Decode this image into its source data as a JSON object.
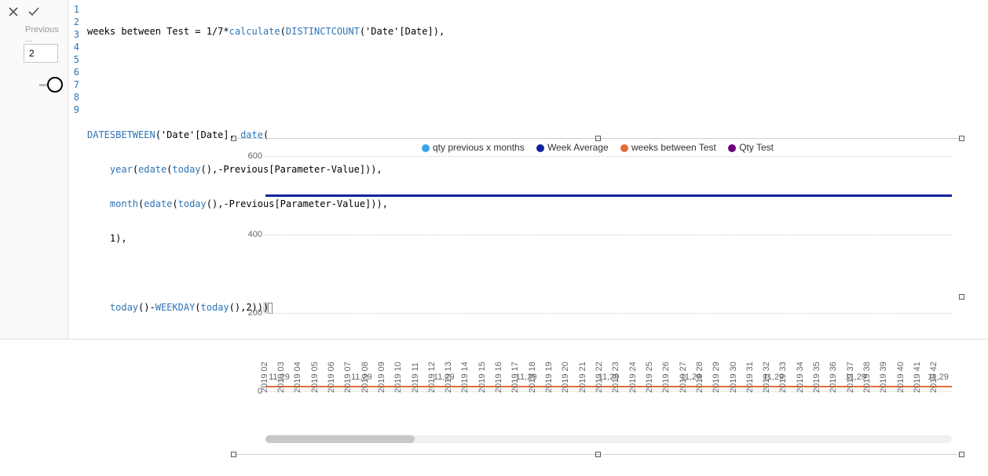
{
  "controls": {
    "truncated_label": "Previous ...",
    "param_value": "2"
  },
  "editor": {
    "lines": [
      "weeks between Test = 1/7*calculate(DISTINCTCOUNT('Date'[Date]),",
      "",
      "",
      "DATESBETWEEN('Date'[Date], date(",
      "    year(edate(today(),-Previous[Parameter-Value])),",
      "    month(edate(today(),-Previous[Parameter-Value])),",
      "    1),",
      "",
      "    today()-WEEKDAY(today(),2)))"
    ],
    "line_numbers": [
      "1",
      "2",
      "3",
      "4",
      "5",
      "6",
      "7",
      "8",
      "9"
    ]
  },
  "legend": {
    "s1": "qty previous x months",
    "s2": "Week Average",
    "s3": "weeks between Test",
    "s4": "Qty Test"
  },
  "chart_data": {
    "type": "line",
    "ylim": [
      0,
      600
    ],
    "yticks": [
      0,
      200,
      400,
      600
    ],
    "categories": [
      "2019 02",
      "2019 03",
      "2019 04",
      "2019 05",
      "2019 06",
      "2019 07",
      "2019 08",
      "2019 09",
      "2019 10",
      "2019 11",
      "2019 12",
      "2019 13",
      "2019 14",
      "2019 15",
      "2019 16",
      "2019 17",
      "2019 18",
      "2019 19",
      "2019 20",
      "2019 21",
      "2019 22",
      "2019 23",
      "2019 24",
      "2019 25",
      "2019 26",
      "2019 27",
      "2019 28",
      "2019 29",
      "2019 30",
      "2019 31",
      "2019 32",
      "2019 33",
      "2019 34",
      "2019 35",
      "2019 36",
      "2019 37",
      "2019 38",
      "2019 39",
      "2019 40",
      "2019 41",
      "2019 42"
    ],
    "series": [
      {
        "name": "Week Average",
        "constant_value": 500,
        "color": "#12239e"
      },
      {
        "name": "weeks between Test",
        "constant_value": 11.29,
        "color": "#e66c37"
      }
    ],
    "data_labels": {
      "text": "11,29",
      "positions_pct": [
        2,
        14,
        26,
        38,
        50,
        62,
        74,
        86,
        98
      ]
    }
  }
}
